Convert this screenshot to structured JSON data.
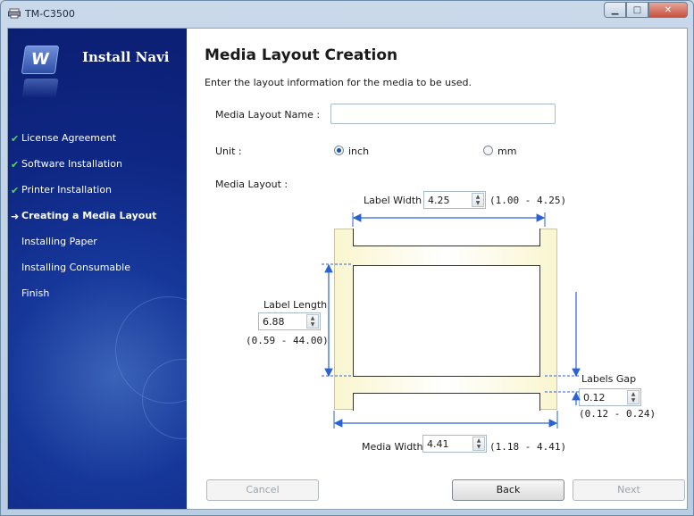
{
  "window": {
    "title": "TM-C3500"
  },
  "sidebar": {
    "brand": "Install Navi",
    "steps": [
      {
        "label": "License Agreement",
        "state": "done"
      },
      {
        "label": "Software Installation",
        "state": "done"
      },
      {
        "label": "Printer Installation",
        "state": "done"
      },
      {
        "label": "Creating a Media Layout",
        "state": "active"
      },
      {
        "label": "Installing Paper",
        "state": "pending"
      },
      {
        "label": "Installing Consumable",
        "state": "pending"
      },
      {
        "label": "Finish",
        "state": "pending"
      }
    ]
  },
  "main": {
    "title": "Media Layout Creation",
    "description": "Enter the layout information for the media to be used.",
    "layout_name": {
      "label": "Media Layout Name :",
      "value": ""
    },
    "unit": {
      "label": "Unit :",
      "options": [
        "inch",
        "mm"
      ],
      "selected": "inch"
    },
    "media_layout_label": "Media Layout :",
    "label_width": {
      "label": "Label Width",
      "value": "4.25",
      "range": "(1.00 - 4.25)"
    },
    "label_length": {
      "label": "Label Length",
      "value": "6.88",
      "range": "(0.59 - 44.00)"
    },
    "labels_gap": {
      "label": "Labels Gap",
      "value": "0.12",
      "range": "(0.12 - 0.24)"
    },
    "media_width": {
      "label": "Media Width",
      "value": "4.41",
      "range": "(1.18 - 4.41)"
    }
  },
  "buttons": {
    "cancel": "Cancel",
    "back": "Back",
    "next": "Next"
  },
  "colors": {
    "sidebar": "#0f2784",
    "check": "#5ed15e",
    "arrow": "#2a62d6"
  }
}
